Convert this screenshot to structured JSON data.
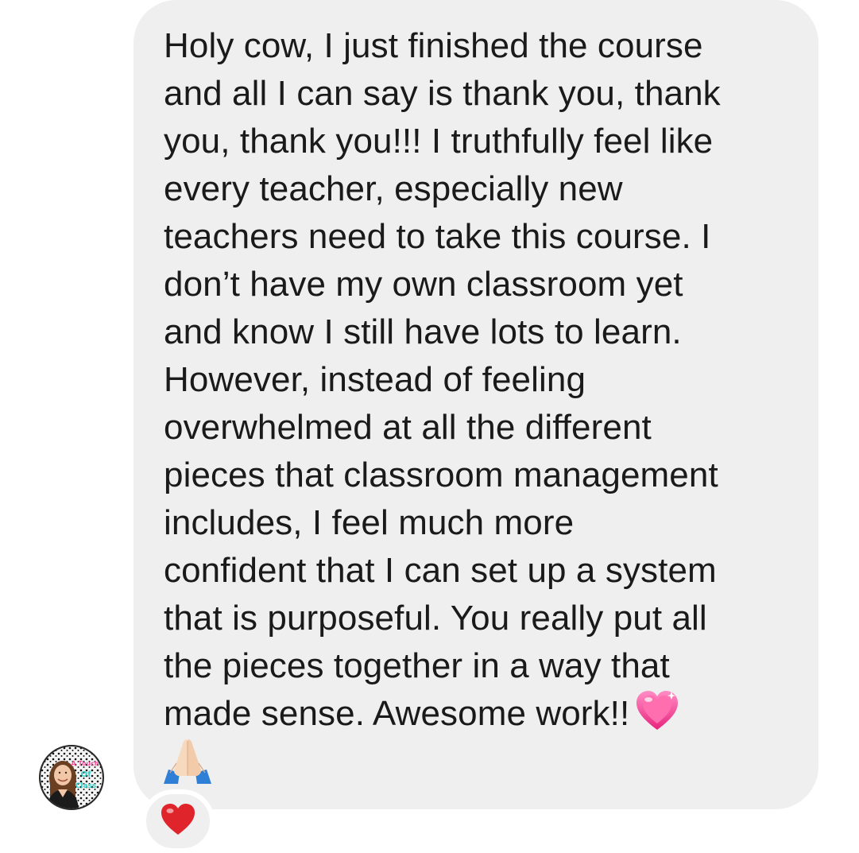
{
  "message": {
    "text": "Holy cow, I just finished the course\nand all I can say is thank you, thank\nyou, thank you!!! I truthfully feel like\nevery teacher, especially new\nteachers need to take this course. I\ndon’t have my own classroom yet\nand know I still have lots to learn.\nHowever, instead of feeling\noverwhelmed at all the different\npieces that classroom management\nincludes, I feel much more\nconfident that I can set up a system\nthat is purposeful. You really put all\nthe pieces together in a way that\nmade sense. Awesome work!!",
    "trailing_emoji": "sparkling-heart-icon",
    "second_line_emoji": "folded-hands-icon"
  },
  "avatar": {
    "alt": "sender-avatar",
    "logo_text": [
      "A Touch",
      "Of",
      "Class"
    ]
  },
  "reaction": {
    "icon": "red-heart-icon"
  },
  "colors": {
    "bubble": "#efeff0",
    "text": "#1a1a1a",
    "heart_red": "#e0242b",
    "heart_pink": "#f3488a"
  }
}
